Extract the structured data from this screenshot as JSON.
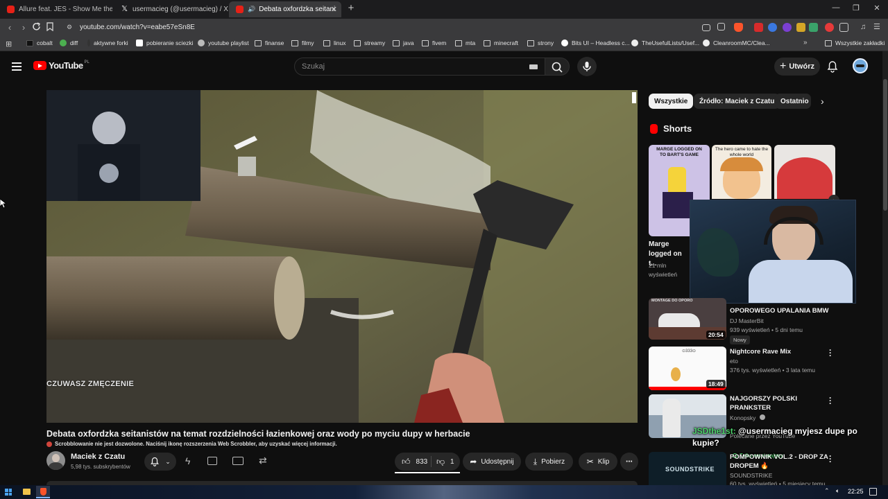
{
  "browser": {
    "tabs": [
      {
        "label": "Allure feat. JES - Show Me the Way (I"
      },
      {
        "label": "usermacieg (@usermacieg) / X"
      },
      {
        "label": "Debata oxfordzka seitanistów"
      }
    ],
    "url": "youtube.com/watch?v=eabe57eSn8E",
    "bookmarks": [
      {
        "label": "cobalt"
      },
      {
        "label": "diff"
      },
      {
        "label": "aktywne forki"
      },
      {
        "label": "pobieranie sciezki"
      },
      {
        "label": "youtube playlist"
      },
      {
        "label": "finanse"
      },
      {
        "label": "filmy"
      },
      {
        "label": "linux"
      },
      {
        "label": "streamy"
      },
      {
        "label": "java"
      },
      {
        "label": "fivem"
      },
      {
        "label": "mta"
      },
      {
        "label": "minecraft"
      },
      {
        "label": "strony"
      },
      {
        "label": "Bits UI – Headless c..."
      },
      {
        "label": "TheUsefulLists/Usef..."
      },
      {
        "label": "CleanroomMC/Clea..."
      }
    ],
    "bookmarks_all": "Wszystkie zakładki"
  },
  "yt": {
    "logo": "YouTube",
    "region": "PL",
    "search_placeholder": "Szukaj",
    "create_label": "Utwórz",
    "video": {
      "overlay_text": "CZUWASZ ZMĘCZENIE",
      "title": "Debata oxfordzka seitanistów na temat rozdzielności łazienkowej oraz wody po myciu dupy w herbacie",
      "scrobble_note": "Scrobblowanie nie jest dozwolone. Naciśnij ikonę rozszerzenia Web Scrobbler, aby uzyskać więcej informacji.",
      "channel": "Maciek z Czatu",
      "subscribers": "5,98 tys. subskrybentów",
      "likes": "833",
      "dislikes": "1",
      "share_label": "Udostępnij",
      "download_label": "Pobierz",
      "clip_label": "Klip"
    },
    "chips": [
      {
        "label": "Wszystkie"
      },
      {
        "label": "Źródło: Maciek z Czatu"
      },
      {
        "label": "Ostatnio p"
      }
    ],
    "shorts": {
      "heading": "Shorts",
      "items": [
        {
          "thumb_text": "MARGE LOGGED ON TO BART'S GAME",
          "title": "Marge logged on t...",
          "views": "21 mln wyświetleń"
        },
        {
          "thumb_text": "The hero came to hate the whole world"
        },
        {
          "thumb_text": ""
        }
      ]
    },
    "recommendations": [
      {
        "title": "OPOROWEGO UPALANIA BMW",
        "channel": "DJ MasterBit",
        "meta": "939 wyświetleń • 5 dni temu",
        "badge": "Nowy",
        "duration": "20:54",
        "thumb_text": "MONTAGE DO OPORO"
      },
      {
        "title": "Nightcore Rave Mix",
        "channel": "eto",
        "meta": "376 tys. wyświetleń • 3 lata temu",
        "duration": "18:49"
      },
      {
        "title": "NAJGORSZY POLSKI",
        "title2": "PRANKSTER",
        "channel": "Konopsky",
        "meta": "Polecane przez YouTube"
      },
      {
        "title": "POMPOWNIK VOL.2 - DROP ZA",
        "title2": "DROPEM 🔥",
        "channel": "SOUNDSTRIKE",
        "meta": "60 tys. wyświetleń • 5 miesięcy temu",
        "thumb_text": "SOUNDSTRIKE"
      }
    ],
    "chat_overlay": {
      "user": "JSDthe1st:",
      "message": "@usermacieg myjesz dupe po kupie?",
      "badge": "Tylko wspierający"
    }
  },
  "taskbar": {
    "time": "22:25"
  }
}
